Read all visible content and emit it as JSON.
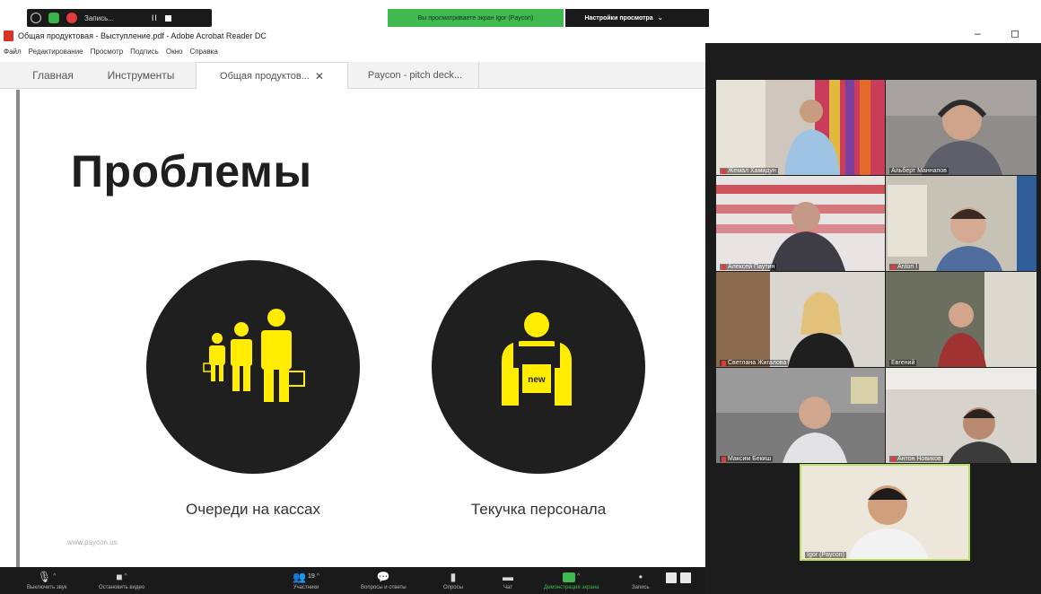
{
  "zoom_top": {
    "rec_label": "Запись...",
    "pause_label": "II",
    "banner": "Вы просматриваете экран Igor (Paycon)",
    "view_settings": "Настройки просмотра",
    "view_caret": "⌄",
    "colors": {
      "banner_bg": "#3fb950",
      "bar_bg": "#1a1a1a"
    }
  },
  "window": {
    "title": "Общая продуктовая - Выступление.pdf - Adobe Acrobat Reader DC",
    "minimize": "–",
    "maximize": "◻"
  },
  "menu": [
    "Файл",
    "Редактирование",
    "Просмотр",
    "Подпись",
    "Окно",
    "Справка"
  ],
  "tabs": [
    {
      "label": "Главная"
    },
    {
      "label": "Инструменты"
    },
    {
      "label": "Общая продуктов...",
      "close": "✕"
    },
    {
      "label": "Paycon - pitch deck..."
    }
  ],
  "slide": {
    "title": "Проблемы",
    "items": [
      {
        "caption": "Очереди на кассах",
        "icon": "queue-people-icon"
      },
      {
        "caption": "Текучка персонала",
        "icon": "new-employee-icon",
        "badge": "new"
      }
    ],
    "url": "www.paycon.us",
    "colors": {
      "accent": "#ffec00",
      "circle": "#1f1f1f"
    }
  },
  "participants": [
    {
      "name": "Жемал Хамидун",
      "muted": true
    },
    {
      "name": "Альберт Маннапов",
      "muted": false
    },
    {
      "name": "Алексей Паутин",
      "muted": true
    },
    {
      "name": "Anton I",
      "muted": true
    },
    {
      "name": "Светлана Жигалова",
      "muted": true
    },
    {
      "name": "Евгений",
      "muted": false
    },
    {
      "name": "Максим Бекиш",
      "muted": true
    },
    {
      "name": "Антон Новиков",
      "muted": true
    },
    {
      "name": "Igor (Paycon)",
      "muted": false
    }
  ],
  "toolbar": {
    "mute": {
      "label": "Выключить звук",
      "icon": "microphone-icon"
    },
    "video": {
      "label": "Остановить видео",
      "icon": "video-camera-icon"
    },
    "participants": {
      "label": "Участники",
      "count": "19",
      "icon": "participants-icon"
    },
    "qa": {
      "label": "Вопросы и ответы",
      "icon": "qa-icon"
    },
    "polls": {
      "label": "Опросы",
      "icon": "polls-icon"
    },
    "chat": {
      "label": "Чат",
      "icon": "chat-icon"
    },
    "share": {
      "label": "Демонстрация экрана",
      "icon": "share-screen-icon"
    },
    "more": {
      "label": "Запись",
      "icon": "more-icon"
    },
    "caret": "^"
  }
}
